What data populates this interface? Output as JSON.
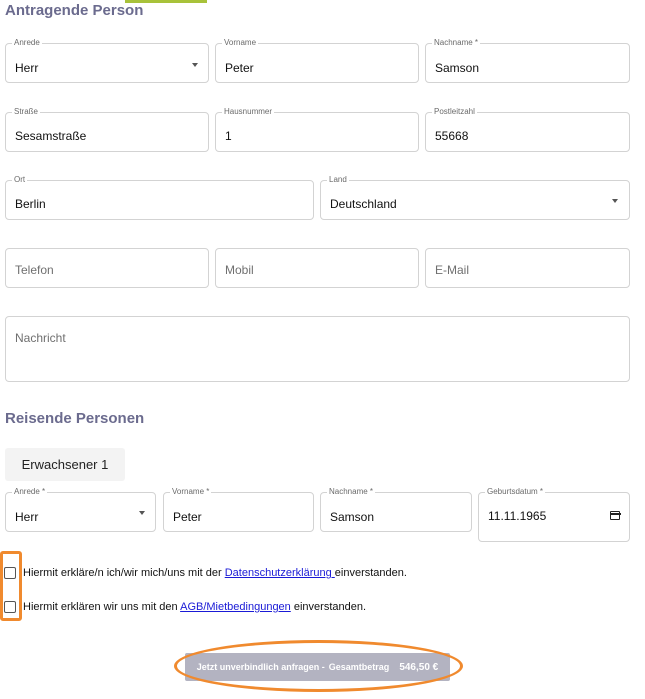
{
  "applicant": {
    "title": "Antragende Person",
    "salutation": {
      "label": "Anrede",
      "value": "Herr"
    },
    "first_name": {
      "label": "Vorname",
      "value": "Peter"
    },
    "last_name": {
      "label": "Nachname *",
      "value": "Samson"
    },
    "street": {
      "label": "Straße",
      "value": "Sesamstraße"
    },
    "house_number": {
      "label": "Hausnummer",
      "value": "1"
    },
    "zip": {
      "label": "Postleitzahl",
      "value": "55668"
    },
    "city": {
      "label": "Ort",
      "value": "Berlin"
    },
    "country": {
      "label": "Land",
      "value": "Deutschland"
    },
    "phone": {
      "placeholder": "Telefon"
    },
    "mobile": {
      "placeholder": "Mobil"
    },
    "email": {
      "placeholder": "E-Mail"
    },
    "message": {
      "placeholder": "Nachricht"
    }
  },
  "travelers": {
    "title": "Reisende Personen",
    "tab_label": "Erwachsener 1",
    "salutation": {
      "label": "Anrede *",
      "value": "Herr"
    },
    "first_name": {
      "label": "Vorname *",
      "value": "Peter"
    },
    "last_name": {
      "label": "Nachname *",
      "value": "Samson"
    },
    "birthdate": {
      "label": "Geburtsdatum *",
      "value": "11.11.1965"
    }
  },
  "consents": {
    "privacy": {
      "prefix": "Hiermit erkläre/n ich/wir mich/uns mit der ",
      "link": "Datenschutzerklärung ",
      "suffix": "einverstanden.",
      "checked": false
    },
    "terms": {
      "prefix": "Hiermit erklären wir uns mit den ",
      "link": "AGB/Mietbedingungen",
      "suffix": " einverstanden.",
      "checked": false
    }
  },
  "submit": {
    "label": "Jetzt unverbindlich anfragen -",
    "total_label": "Gesamtbetrag",
    "total_value": "546,50 €"
  },
  "colors": {
    "section_title": "#6b6b8e",
    "accent": "#a8c23a",
    "highlight": "#f08a2e",
    "button": "#b3b3c1",
    "link": "#1a1ad6"
  }
}
